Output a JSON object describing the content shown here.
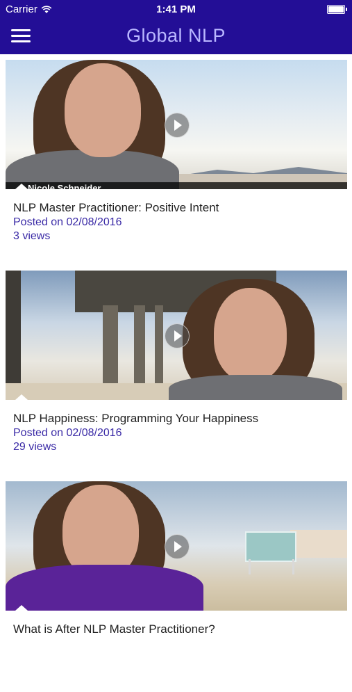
{
  "status_bar": {
    "carrier": "Carrier",
    "time": "1:41 PM"
  },
  "nav": {
    "title": "Global NLP"
  },
  "icons": [
    "wifi-icon",
    "battery-icon",
    "hamburger-menu-icon",
    "play-icon"
  ],
  "colors": {
    "nav_background": "#230e96",
    "title_color": "#b9b6ff",
    "meta_text": "#3a2aa6"
  },
  "videos": [
    {
      "thumbnail_caption": "Nicole Schneider",
      "title": "NLP Master Practitioner: Positive Intent",
      "posted": "Posted on 02/08/2016",
      "views": "3 views"
    },
    {
      "thumbnail_caption": "",
      "title": "NLP Happiness: Programming Your Happiness",
      "posted": "Posted on 02/08/2016",
      "views": "29 views"
    },
    {
      "thumbnail_caption": "",
      "title": "What is After NLP Master Practitioner?",
      "posted": "",
      "views": ""
    }
  ]
}
